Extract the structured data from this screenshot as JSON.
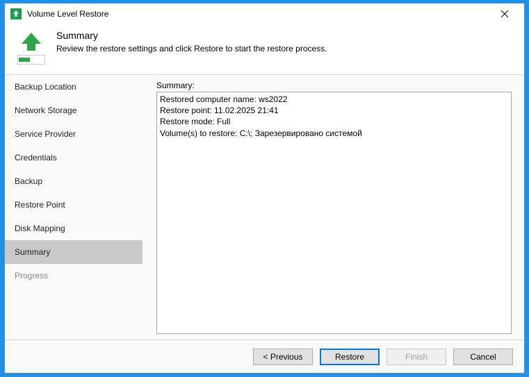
{
  "window": {
    "title": "Volume Level Restore"
  },
  "header": {
    "title": "Summary",
    "subtitle": "Review the restore settings and click Restore to start the restore process."
  },
  "sidebar": {
    "steps": [
      {
        "label": "Backup Location",
        "state": "done"
      },
      {
        "label": "Network Storage",
        "state": "done"
      },
      {
        "label": "Service Provider",
        "state": "done"
      },
      {
        "label": "Credentials",
        "state": "done"
      },
      {
        "label": "Backup",
        "state": "done"
      },
      {
        "label": "Restore Point",
        "state": "done"
      },
      {
        "label": "Disk Mapping",
        "state": "done"
      },
      {
        "label": "Summary",
        "state": "active"
      },
      {
        "label": "Progress",
        "state": "disabled"
      }
    ]
  },
  "content": {
    "summary_label": "Summary:",
    "summary_text": "Restored computer name: ws2022\nRestore point: 11.02.2025 21:41\nRestore mode: Full\nVolume(s) to restore: C:\\; Зарезервировано системой"
  },
  "footer": {
    "previous": "< Previous",
    "restore": "Restore",
    "finish": "Finish",
    "cancel": "Cancel"
  }
}
